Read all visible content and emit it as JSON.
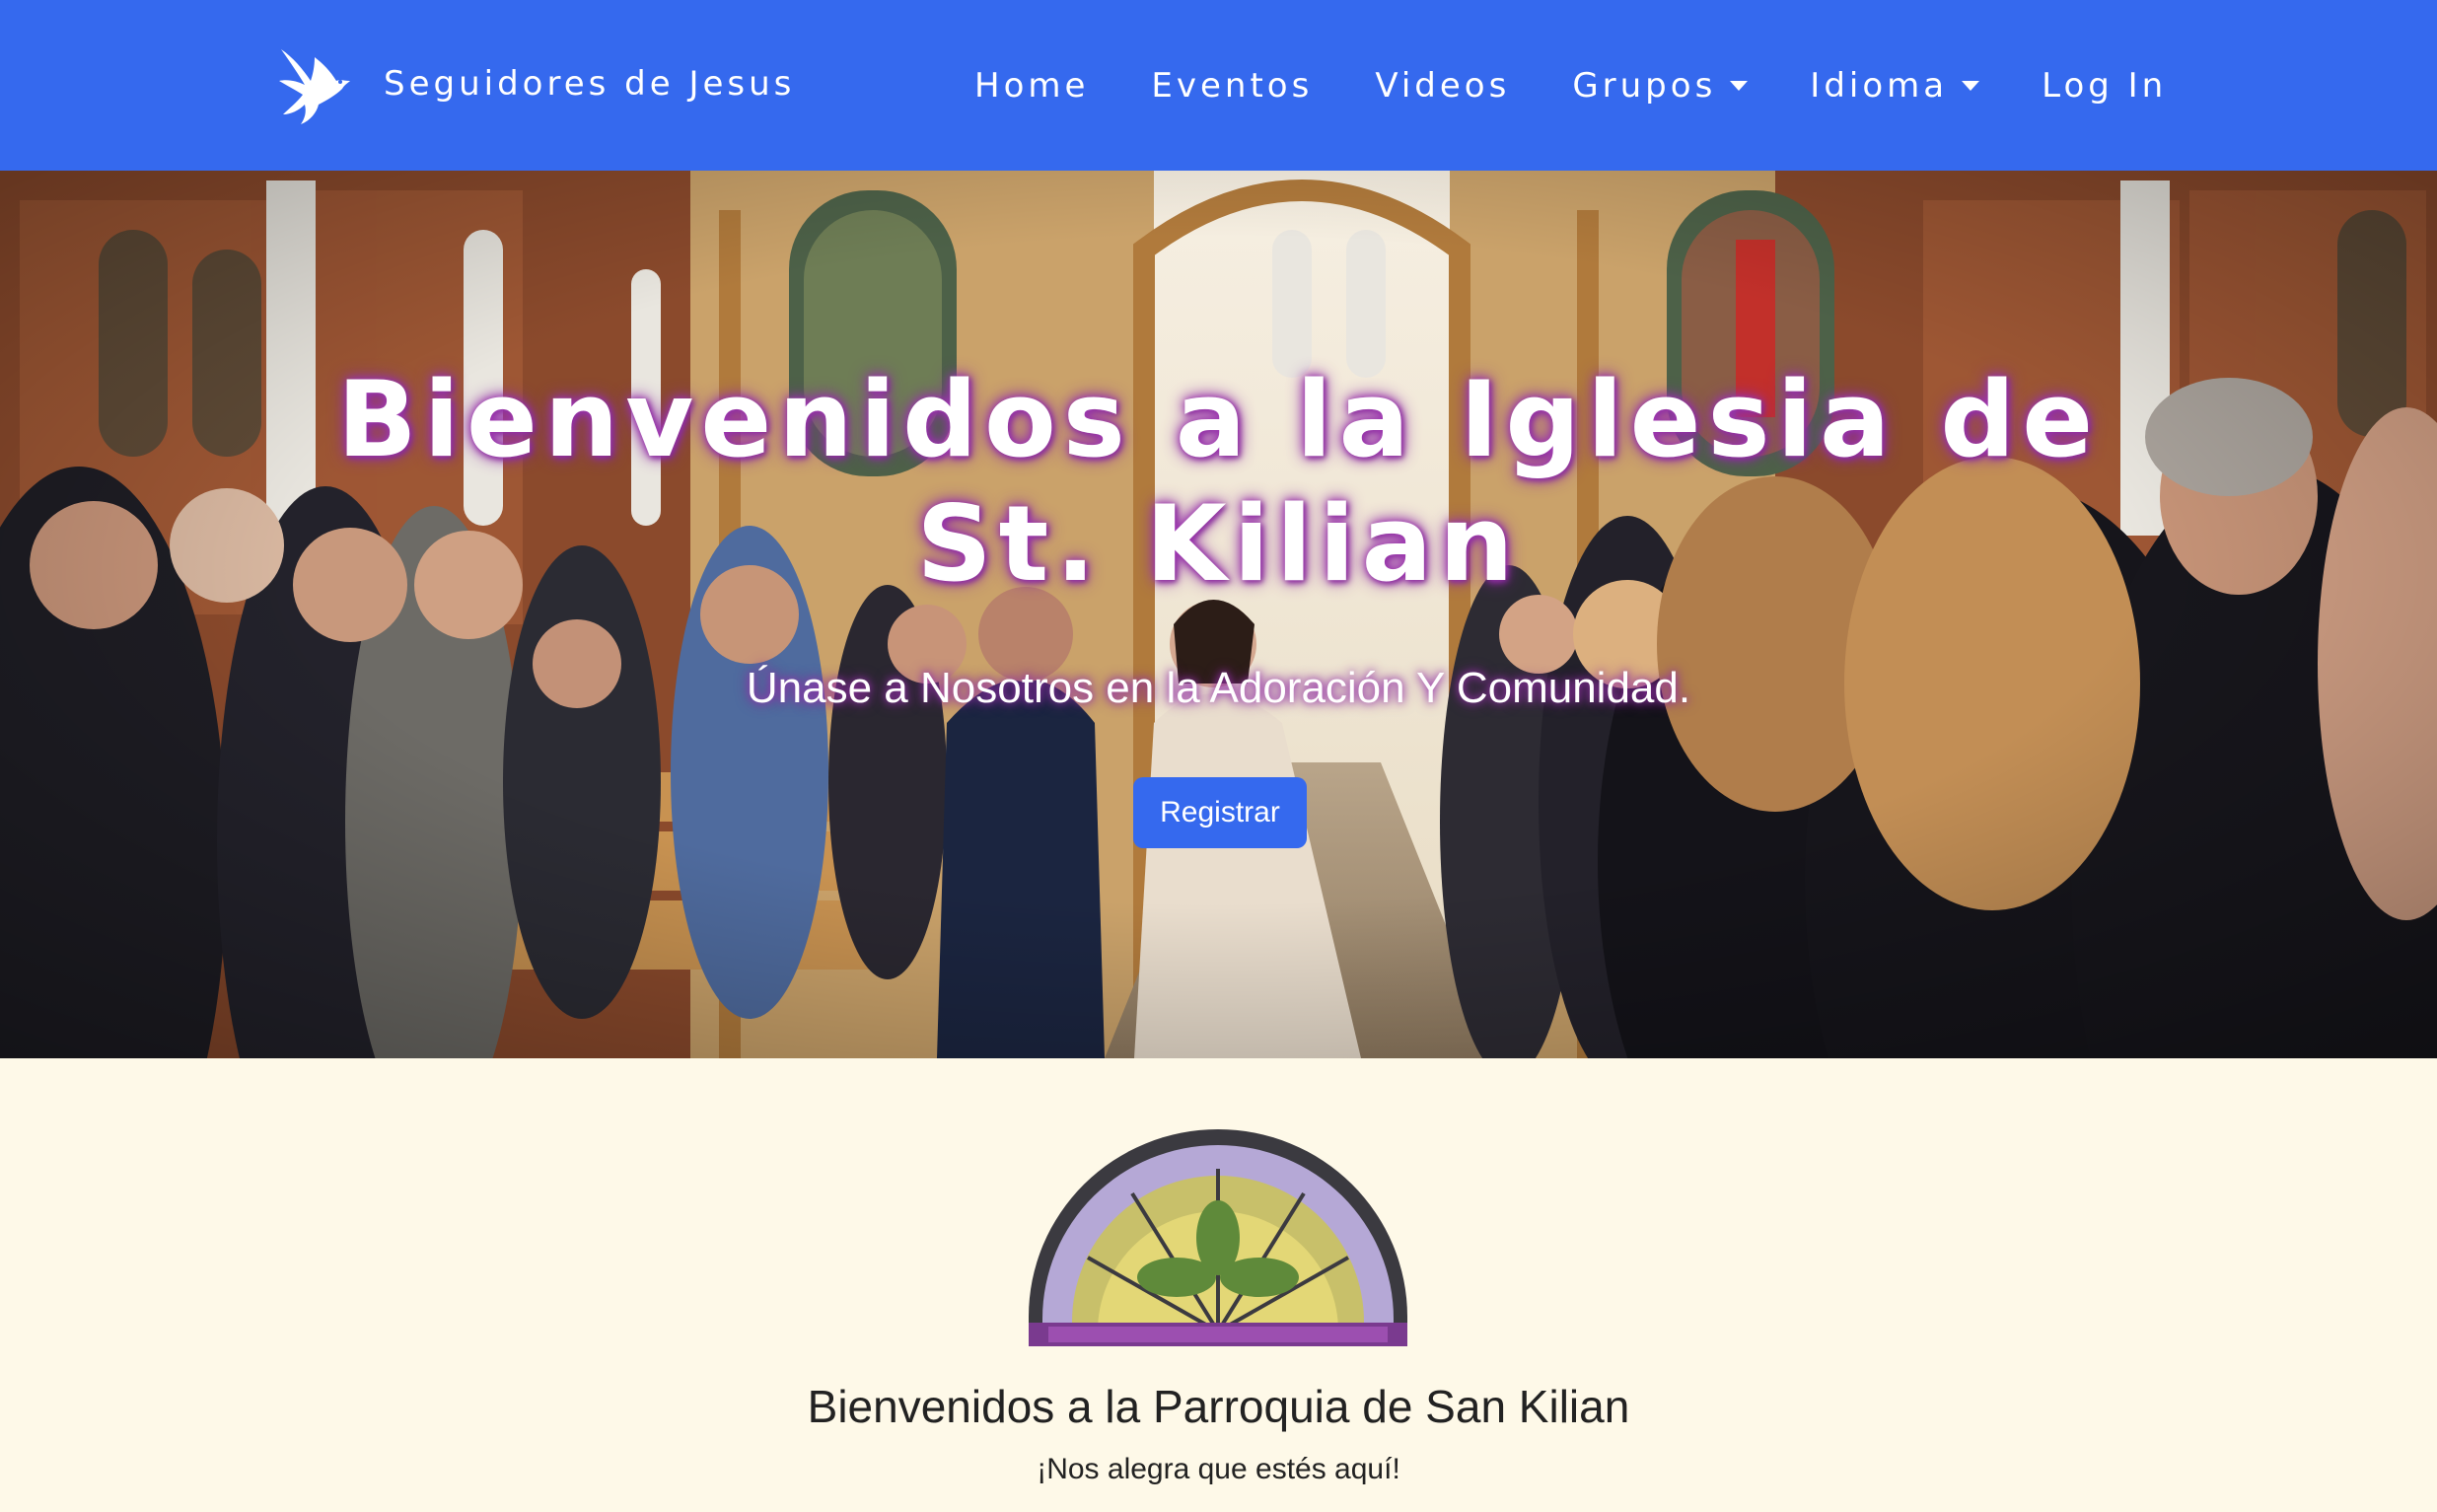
{
  "navbar": {
    "brand_text": "Seguidores de Jesus",
    "links": [
      {
        "label": "Home",
        "dropdown": false
      },
      {
        "label": "Eventos",
        "dropdown": false
      },
      {
        "label": "Videos",
        "dropdown": false
      },
      {
        "label": "Grupos",
        "dropdown": true
      },
      {
        "label": "Idioma",
        "dropdown": true
      },
      {
        "label": "Log In",
        "dropdown": false
      }
    ],
    "color": "#3569ee"
  },
  "hero": {
    "title_line1": "Bienvenidos a la Iglesia de",
    "title_line2": "St. Kilian",
    "subtitle": "Únase a Nosotros en la Adoración Y Comunidad.",
    "button_label": "Registrar",
    "image": "church-wedding-procession-photo"
  },
  "welcome": {
    "image": "stained-glass-window",
    "title": "Bienvenidos a la Parroquia de San Kilian",
    "subtitle": "¡Nos alegra que estés aquí!"
  },
  "colors": {
    "accent": "#3569ee",
    "page_background": "#fef9e8",
    "title_glow": "#a43bb6"
  }
}
